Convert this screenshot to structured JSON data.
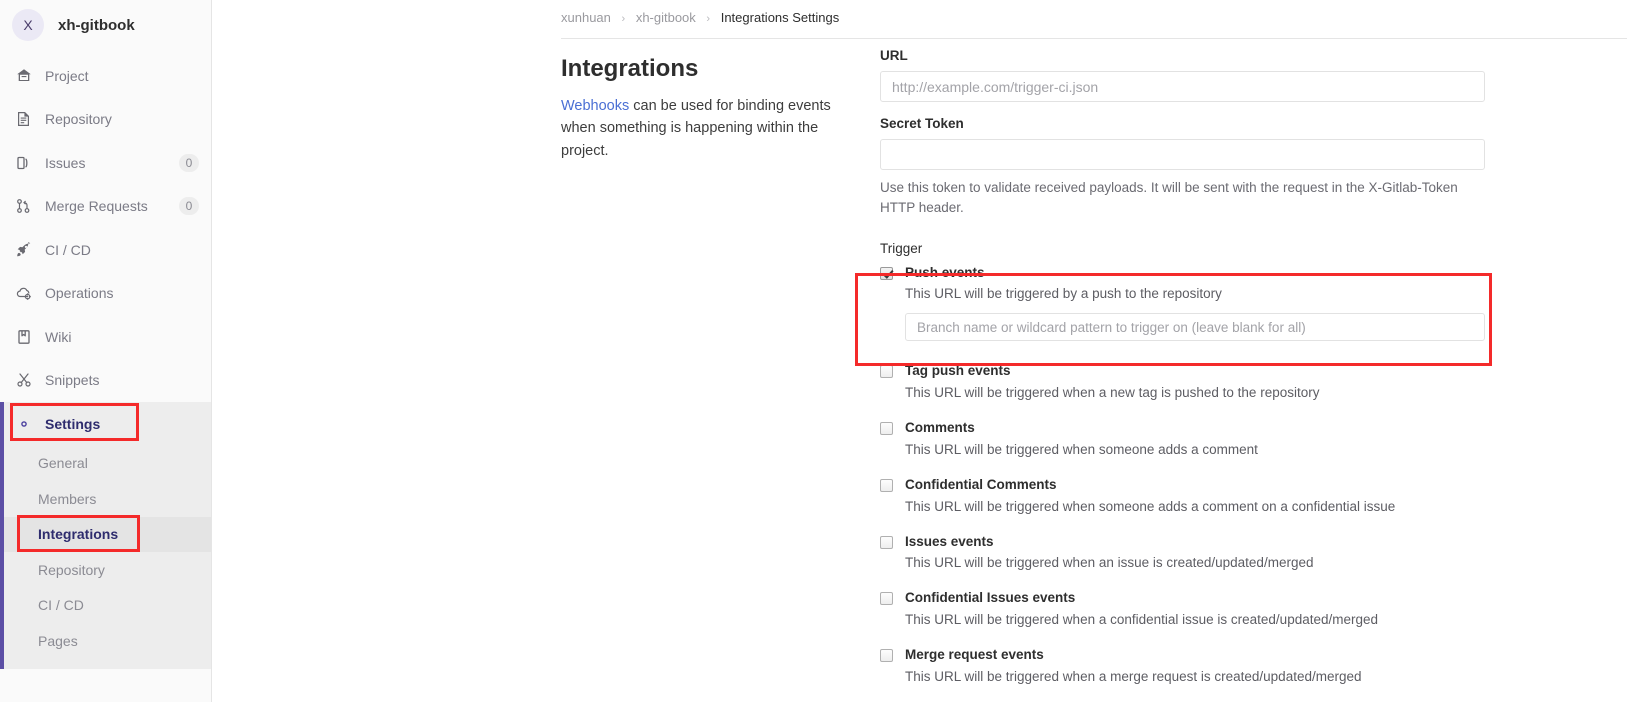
{
  "sidebar": {
    "project": {
      "avatar_letter": "X",
      "name": "xh-gitbook"
    },
    "items": [
      {
        "label": "Project",
        "icon": "home-icon",
        "badge": null
      },
      {
        "label": "Repository",
        "icon": "document-icon",
        "badge": null
      },
      {
        "label": "Issues",
        "icon": "issue-icon",
        "badge": "0"
      },
      {
        "label": "Merge Requests",
        "icon": "merge-request-icon",
        "badge": "0"
      },
      {
        "label": "CI / CD",
        "icon": "rocket-icon",
        "badge": null
      },
      {
        "label": "Operations",
        "icon": "cloud-gear-icon",
        "badge": null
      },
      {
        "label": "Wiki",
        "icon": "book-icon",
        "badge": null
      },
      {
        "label": "Snippets",
        "icon": "scissors-icon",
        "badge": null
      },
      {
        "label": "Settings",
        "icon": "gear-icon",
        "badge": null
      }
    ],
    "settings_submenu": [
      {
        "label": "General"
      },
      {
        "label": "Members"
      },
      {
        "label": "Integrations"
      },
      {
        "label": "Repository"
      },
      {
        "label": "CI / CD"
      },
      {
        "label": "Pages"
      }
    ]
  },
  "breadcrumb": {
    "group": "xunhuan",
    "project": "xh-gitbook",
    "page": "Integrations Settings",
    "separator": "›"
  },
  "section": {
    "title": "Integrations",
    "desc_link": "Webhooks",
    "desc_rest": " can be used for binding events when something is happening within the project."
  },
  "form": {
    "url_label": "URL",
    "url_value": "",
    "url_placeholder": "http://example.com/trigger-ci.json",
    "token_label": "Secret Token",
    "token_value": "",
    "token_placeholder": "",
    "token_help": "Use this token to validate received payloads. It will be sent with the request in the X-Gitlab-Token HTTP header.",
    "trigger_label": "Trigger"
  },
  "events": [
    {
      "name": "Push events",
      "desc": "This URL will be triggered by a push to the repository",
      "checked": true,
      "branch_value": "",
      "branch_placeholder": "Branch name or wildcard pattern to trigger on (leave blank for all)"
    },
    {
      "name": "Tag push events",
      "desc": "This URL will be triggered when a new tag is pushed to the repository",
      "checked": false
    },
    {
      "name": "Comments",
      "desc": "This URL will be triggered when someone adds a comment",
      "checked": false
    },
    {
      "name": "Confidential Comments",
      "desc": "This URL will be triggered when someone adds a comment on a confidential issue",
      "checked": false
    },
    {
      "name": "Issues events",
      "desc": "This URL will be triggered when an issue is created/updated/merged",
      "checked": false
    },
    {
      "name": "Confidential Issues events",
      "desc": "This URL will be triggered when a confidential issue is created/updated/merged",
      "checked": false
    },
    {
      "name": "Merge request events",
      "desc": "This URL will be triggered when a merge request is created/updated/merged",
      "checked": false
    }
  ],
  "colors": {
    "annotation_red": "#f42a2a",
    "active_purple": "#5c4fa5",
    "active_text": "#2e2c6e",
    "link_blue": "#4a6fd4"
  }
}
